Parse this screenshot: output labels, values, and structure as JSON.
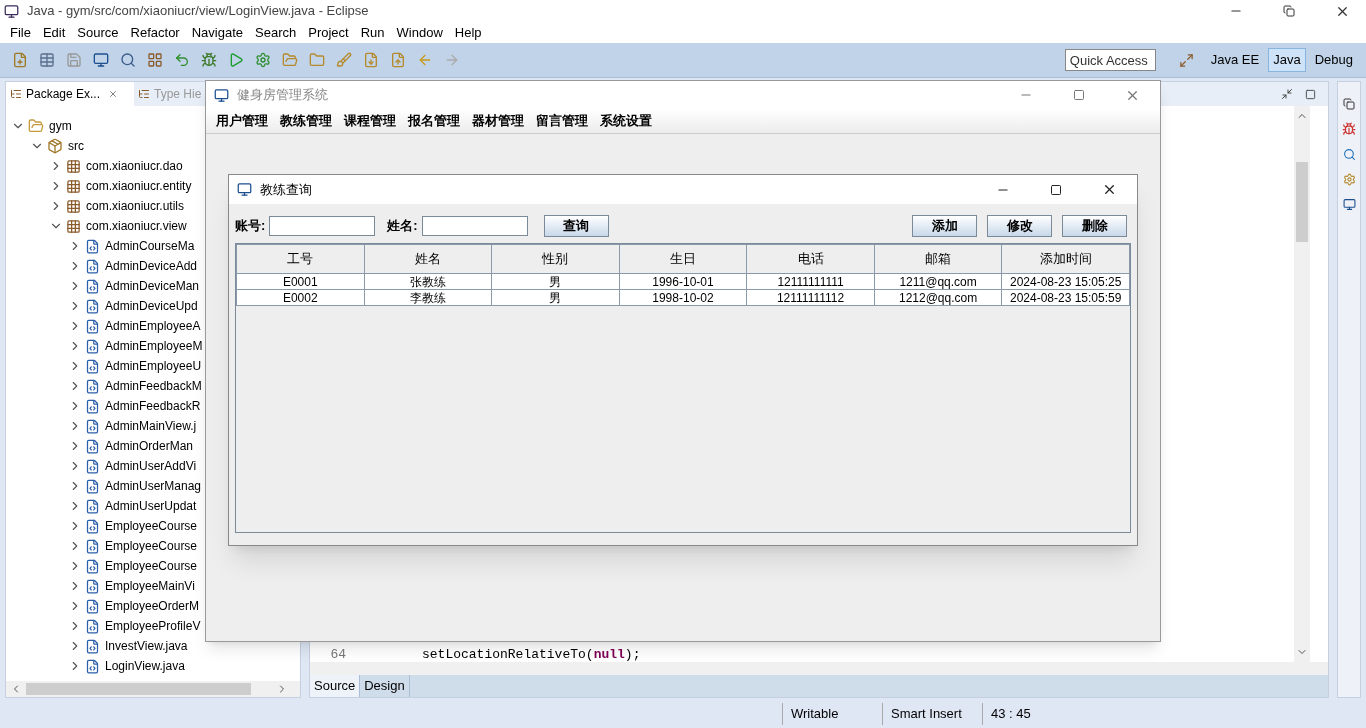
{
  "window": {
    "title": "Java - gym/src/com/xiaoniucr/view/LoginView.java - Eclipse"
  },
  "menu": [
    "File",
    "Edit",
    "Source",
    "Refactor",
    "Navigate",
    "Search",
    "Project",
    "Run",
    "Window",
    "Help"
  ],
  "quick_access": {
    "placeholder": "Quick Access"
  },
  "perspectives": [
    {
      "label": "Java EE",
      "selected": false
    },
    {
      "label": "Java",
      "selected": true
    },
    {
      "label": "Debug",
      "selected": false
    }
  ],
  "views": [
    {
      "label": "Package Ex...",
      "selected": true
    },
    {
      "label": "Type Hie",
      "selected": false
    }
  ],
  "tree": [
    {
      "label": "gym",
      "kind": "project",
      "expanded": true,
      "children": [
        {
          "label": "src",
          "kind": "folder",
          "expanded": true,
          "children": [
            {
              "label": "com.xiaoniucr.dao",
              "kind": "package",
              "expanded": false
            },
            {
              "label": "com.xiaoniucr.entity",
              "kind": "package",
              "expanded": false
            },
            {
              "label": "com.xiaoniucr.utils",
              "kind": "package",
              "expanded": false
            },
            {
              "label": "com.xiaoniucr.view",
              "kind": "package",
              "expanded": true,
              "children": [
                {
                  "label": "AdminCourseMa",
                  "kind": "file",
                  "expanded": false
                },
                {
                  "label": "AdminDeviceAdd",
                  "kind": "file",
                  "expanded": false
                },
                {
                  "label": "AdminDeviceMan",
                  "kind": "file",
                  "expanded": false
                },
                {
                  "label": "AdminDeviceUpd",
                  "kind": "file",
                  "expanded": false
                },
                {
                  "label": "AdminEmployeeA",
                  "kind": "file",
                  "expanded": false
                },
                {
                  "label": "AdminEmployeeM",
                  "kind": "file",
                  "expanded": false
                },
                {
                  "label": "AdminEmployeeU",
                  "kind": "file",
                  "expanded": false
                },
                {
                  "label": "AdminFeedbackM",
                  "kind": "file",
                  "expanded": false
                },
                {
                  "label": "AdminFeedbackR",
                  "kind": "file",
                  "expanded": false
                },
                {
                  "label": "AdminMainView.j",
                  "kind": "file",
                  "expanded": false
                },
                {
                  "label": "AdminOrderMan",
                  "kind": "file",
                  "expanded": false
                },
                {
                  "label": "AdminUserAddVi",
                  "kind": "file",
                  "expanded": false
                },
                {
                  "label": "AdminUserManag",
                  "kind": "file",
                  "expanded": false
                },
                {
                  "label": "AdminUserUpdat",
                  "kind": "file",
                  "expanded": false
                },
                {
                  "label": "EmployeeCourse",
                  "kind": "file",
                  "expanded": false
                },
                {
                  "label": "EmployeeCourse",
                  "kind": "file",
                  "expanded": false
                },
                {
                  "label": "EmployeeCourse",
                  "kind": "file",
                  "expanded": false
                },
                {
                  "label": "EmployeeMainVi",
                  "kind": "file",
                  "expanded": false
                },
                {
                  "label": "EmployeeOrderM",
                  "kind": "file",
                  "expanded": false
                },
                {
                  "label": "EmployeeProfileV",
                  "kind": "file",
                  "expanded": false
                },
                {
                  "label": "InvestView.java",
                  "kind": "file",
                  "expanded": false
                },
                {
                  "label": "LoginView.java",
                  "kind": "file",
                  "expanded": false
                }
              ]
            }
          ]
        }
      ]
    }
  ],
  "editor": {
    "line_number": "64",
    "code": [
      {
        "text": "setLocationRelativeTo(",
        "kind": "plain"
      },
      {
        "text": "null",
        "kind": "keyword"
      },
      {
        "text": ");",
        "kind": "plain"
      }
    ]
  },
  "editor_tabs": [
    {
      "label": "Source",
      "selected": true
    },
    {
      "label": "Design",
      "selected": false
    }
  ],
  "status_bar": [
    "Writable",
    "Smart Insert",
    "43 : 45"
  ],
  "app_window": {
    "title": "健身房管理系统",
    "menu": [
      "用户管理",
      "教练管理",
      "课程管理",
      "报名管理",
      "器材管理",
      "留言管理",
      "系统设置"
    ]
  },
  "dialog": {
    "title": "教练查询",
    "fields": [
      {
        "label": "账号:"
      },
      {
        "label": "姓名:"
      }
    ],
    "search_button": "查询",
    "buttons": [
      "添加",
      "修改",
      "删除"
    ],
    "table": {
      "columns": [
        "工号",
        "姓名",
        "性别",
        "生日",
        "电话",
        "邮箱",
        "添加时间"
      ],
      "rows": [
        [
          "E0001",
          "张教练",
          "男",
          "1996-10-01",
          "12111111111",
          "1211@qq.com",
          "2024-08-23 15:05:25"
        ],
        [
          "E0002",
          "李教练",
          "男",
          "1998-10-02",
          "12111111112",
          "1212@qq.com",
          "2024-08-23 15:05:59"
        ]
      ]
    }
  }
}
